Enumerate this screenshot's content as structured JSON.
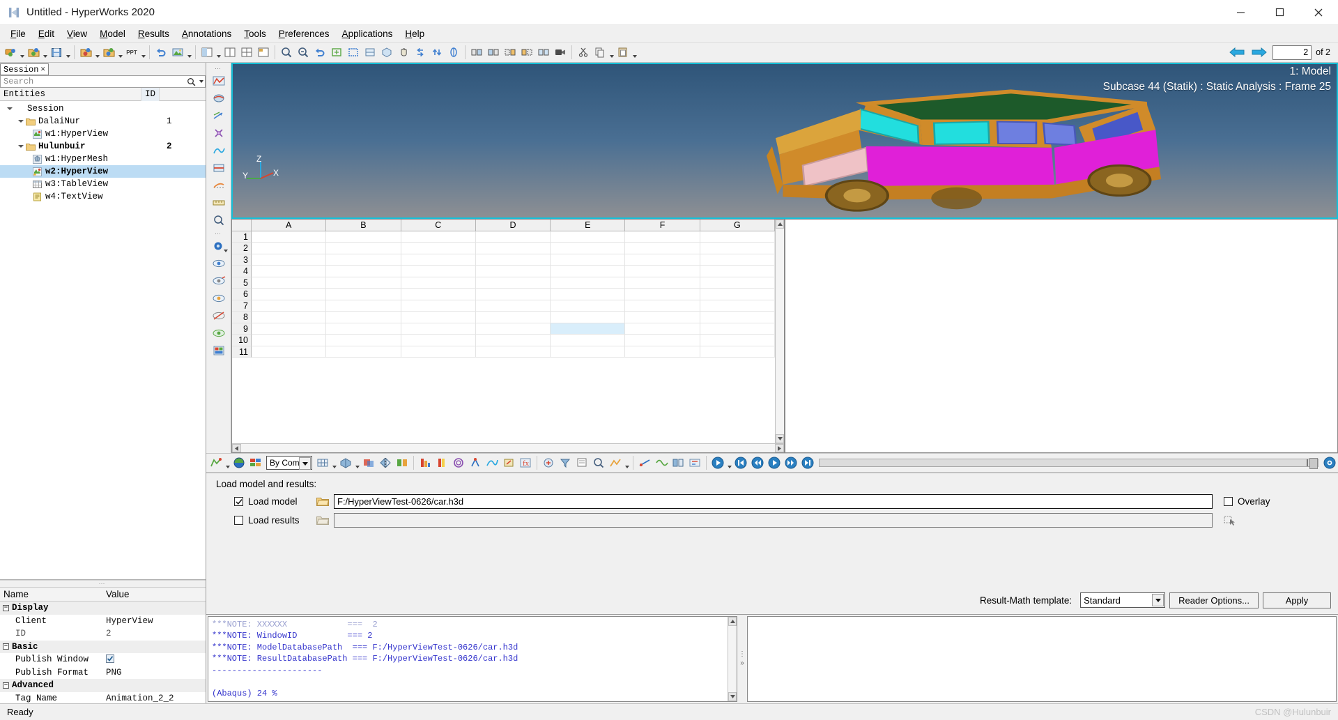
{
  "window": {
    "title": "Untitled - HyperWorks 2020",
    "logo_icon": "hyperworks-logo-icon",
    "minimize_label": "─",
    "maximize_label": "☐",
    "close_label": "✕"
  },
  "menubar": {
    "items": [
      {
        "label": "File",
        "mnemonic": "F"
      },
      {
        "label": "Edit",
        "mnemonic": "E"
      },
      {
        "label": "View",
        "mnemonic": "V"
      },
      {
        "label": "Model",
        "mnemonic": "M"
      },
      {
        "label": "Results",
        "mnemonic": "R"
      },
      {
        "label": "Annotations",
        "mnemonic": "A"
      },
      {
        "label": "Tools",
        "mnemonic": "T"
      },
      {
        "label": "Preferences",
        "mnemonic": "P"
      },
      {
        "label": "Applications",
        "mnemonic": "A"
      },
      {
        "label": "Help",
        "mnemonic": "H"
      }
    ]
  },
  "toolbar": {
    "ppt_label": "PPT",
    "page_value": "2",
    "page_of": "of 2",
    "prev_icon": "arrow-left-icon",
    "next_icon": "arrow-right-icon"
  },
  "browser": {
    "tab_label": "Session",
    "tab_close_icon": "close-icon",
    "search_placeholder": "Search",
    "search_value": "",
    "search_icon": "search-icon",
    "columns": {
      "entities": "Entities",
      "id": "ID"
    },
    "tree": [
      {
        "label": "Session",
        "id": "",
        "depth": 0,
        "icon": "",
        "expanded": true,
        "bold": false,
        "selected": false
      },
      {
        "label": "DalaiNur",
        "id": "1",
        "depth": 1,
        "icon": "folder-icon",
        "expanded": true,
        "bold": false,
        "selected": false
      },
      {
        "label": "w1:HyperView",
        "id": "",
        "depth": 2,
        "icon": "hyperview-icon",
        "expanded": false,
        "bold": false,
        "selected": false
      },
      {
        "label": "Hulunbuir",
        "id": "2",
        "depth": 1,
        "icon": "folder-icon",
        "expanded": true,
        "bold": true,
        "selected": false
      },
      {
        "label": "w1:HyperMesh",
        "id": "",
        "depth": 2,
        "icon": "hypermesh-icon",
        "expanded": false,
        "bold": false,
        "selected": false
      },
      {
        "label": "w2:HyperView",
        "id": "",
        "depth": 2,
        "icon": "hyperview-icon",
        "expanded": false,
        "bold": true,
        "selected": true
      },
      {
        "label": "w3:TableView",
        "id": "",
        "depth": 2,
        "icon": "tableview-icon",
        "expanded": false,
        "bold": false,
        "selected": false
      },
      {
        "label": "w4:TextView",
        "id": "",
        "depth": 2,
        "icon": "textview-icon",
        "expanded": false,
        "bold": false,
        "selected": false
      }
    ]
  },
  "properties": {
    "header": {
      "name": "Name",
      "value": "Value"
    },
    "rows": [
      {
        "kind": "group",
        "name": "Display",
        "value": "",
        "collapse": "−"
      },
      {
        "kind": "item",
        "name": "Client",
        "value": "HyperView"
      },
      {
        "kind": "item",
        "name": "ID",
        "value": "2",
        "dim": true
      },
      {
        "kind": "group",
        "name": "Basic",
        "value": "",
        "collapse": "−"
      },
      {
        "kind": "check",
        "name": "Publish Window",
        "value": "",
        "checked": true
      },
      {
        "kind": "item",
        "name": "Publish Format",
        "value": "PNG"
      },
      {
        "kind": "group",
        "name": "Advanced",
        "value": "",
        "collapse": "−"
      },
      {
        "kind": "item",
        "name": "Tag Name",
        "value": "Animation_2_2"
      }
    ]
  },
  "view3d": {
    "window_label": "1: Model",
    "subcase_label": "Subcase 44 (Statik) : Static Analysis : Frame 25",
    "axis_x": "X",
    "axis_y": "Y",
    "axis_z": "Z",
    "left_axis_x": "X",
    "left_axis_y": "Y",
    "left_axis_z": "Z"
  },
  "spreadsheet": {
    "columns": [
      "A",
      "B",
      "C",
      "D",
      "E",
      "F",
      "G"
    ],
    "rows": [
      "1",
      "2",
      "3",
      "4",
      "5",
      "6",
      "7",
      "8",
      "9",
      "10",
      "11"
    ],
    "selected_cell": {
      "row": 9,
      "col": "E"
    }
  },
  "animbar": {
    "by_comp_label": "By Comp",
    "first_icon": "skip-first-icon",
    "rewind_icon": "rewind-icon",
    "play_icon": "play-icon",
    "forward_icon": "forward-icon",
    "last_icon": "skip-last-icon"
  },
  "loadpanel": {
    "title": "Load model and results:",
    "load_model": {
      "label": "Load model",
      "checked": true,
      "path": "F:/HyperViewTest-0626/car.h3d",
      "folder_icon": "folder-open-icon"
    },
    "load_results": {
      "label": "Load results",
      "checked": false,
      "path": "",
      "folder_icon": "folder-open-icon"
    },
    "overlay": {
      "label": "Overlay",
      "checked": false
    },
    "result_math_label": "Result-Math template:",
    "result_math_value": "Standard",
    "reader_options_label": "Reader Options...",
    "apply_label": "Apply"
  },
  "log": {
    "lines": [
      "***NOTE: WindowID          === 2",
      "***NOTE: ModelDatabasePath  === F:/HyperViewTest-0626/car.h3d",
      "***NOTE: ResultDatabasePath === F:/HyperViewTest-0626/car.h3d",
      "----------------------",
      "",
      "(Abaqus) 24 %"
    ]
  },
  "statusbar": {
    "text": "Ready",
    "watermark": "CSDN @Hulunbuir"
  },
  "colors": {
    "accent": "#16c0d8",
    "selection": "#bcdcf4",
    "panel": "#f0f0f0",
    "log_text": "#3333cc"
  }
}
